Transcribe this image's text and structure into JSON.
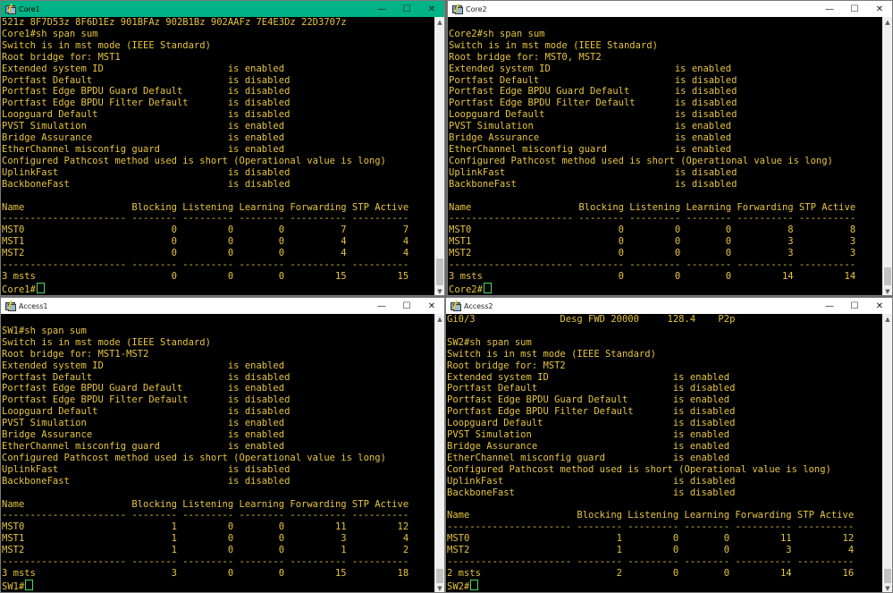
{
  "controls": {
    "minimize": "—",
    "maximize": "☐",
    "close": "✕",
    "scroll_up": "▲",
    "scroll_down": "▼"
  },
  "windows": {
    "core1": {
      "title": "Core1",
      "lines": [
        "521z 8F7D53z 8F6D1Ez 901BFAz 902B1Bz 902AAFz 7E4E3Dz 22D3707z",
        "Core1#sh span sum",
        "Switch is in mst mode (IEEE Standard)",
        "Root bridge for: MST1",
        "Extended system ID                      is enabled",
        "Portfast Default                        is disabled",
        "Portfast Edge BPDU Guard Default        is disabled",
        "Portfast Edge BPDU Filter Default       is disabled",
        "Loopguard Default                       is disabled",
        "PVST Simulation                         is enabled",
        "Bridge Assurance                        is enabled",
        "EtherChannel misconfig guard            is enabled",
        "Configured Pathcost method used is short (Operational value is long)",
        "UplinkFast                              is disabled",
        "BackboneFast                            is disabled",
        "",
        "Name                   Blocking Listening Learning Forwarding STP Active",
        "---------------------- -------- --------- -------- ---------- ----------",
        "MST0                          0         0        0          7          7",
        "MST1                          0         0        0          4          4",
        "MST2                          0         0        0          4          4",
        "---------------------- -------- --------- -------- ---------- ----------",
        "3 msts                        0         0        0         15         15"
      ],
      "prompt": "Core1#"
    },
    "core2": {
      "title": "Core2",
      "lines": [
        "",
        "Core2#sh span sum",
        "Switch is in mst mode (IEEE Standard)",
        "Root bridge for: MST0, MST2",
        "Extended system ID                      is enabled",
        "Portfast Default                        is disabled",
        "Portfast Edge BPDU Guard Default        is disabled",
        "Portfast Edge BPDU Filter Default       is disabled",
        "Loopguard Default                       is disabled",
        "PVST Simulation                         is enabled",
        "Bridge Assurance                        is enabled",
        "EtherChannel misconfig guard            is enabled",
        "Configured Pathcost method used is short (Operational value is long)",
        "UplinkFast                              is disabled",
        "BackboneFast                            is disabled",
        "",
        "Name                   Blocking Listening Learning Forwarding STP Active",
        "---------------------- -------- --------- -------- ---------- ----------",
        "MST0                          0         0        0          8          8",
        "MST1                          0         0        0          3          3",
        "MST2                          0         0        0          3          3",
        "---------------------- -------- --------- -------- ---------- ----------",
        "3 msts                        0         0        0         14         14"
      ],
      "prompt": "Core2#"
    },
    "access1": {
      "title": "Access1",
      "lines": [
        "",
        "SW1#sh span sum",
        "Switch is in mst mode (IEEE Standard)",
        "Root bridge for: MST1-MST2",
        "Extended system ID                      is enabled",
        "Portfast Default                        is disabled",
        "Portfast Edge BPDU Guard Default        is enabled",
        "Portfast Edge BPDU Filter Default       is disabled",
        "Loopguard Default                       is disabled",
        "PVST Simulation                         is enabled",
        "Bridge Assurance                        is enabled",
        "EtherChannel misconfig guard            is enabled",
        "Configured Pathcost method used is short (Operational value is long)",
        "UplinkFast                              is disabled",
        "BackboneFast                            is disabled",
        "",
        "Name                   Blocking Listening Learning Forwarding STP Active",
        "---------------------- -------- --------- -------- ---------- ----------",
        "MST0                          1         0        0         11         12",
        "MST1                          1         0        0          3          4",
        "MST2                          1         0        0          1          2",
        "---------------------- -------- --------- -------- ---------- ----------",
        "3 msts                        3         0        0         15         18"
      ],
      "prompt": "SW1#"
    },
    "access2": {
      "title": "Access2",
      "lines": [
        "Gi0/3               Desg FWD 20000     128.4    P2p",
        "",
        "SW2#sh span sum",
        "Switch is in mst mode (IEEE Standard)",
        "Root bridge for: MST2",
        "Extended system ID                      is enabled",
        "Portfast Default                        is disabled",
        "Portfast Edge BPDU Guard Default        is enabled",
        "Portfast Edge BPDU Filter Default       is disabled",
        "Loopguard Default                       is disabled",
        "PVST Simulation                         is enabled",
        "Bridge Assurance                        is enabled",
        "EtherChannel misconfig guard            is enabled",
        "Configured Pathcost method used is short (Operational value is long)",
        "UplinkFast                              is disabled",
        "BackboneFast                            is disabled",
        "",
        "Name                   Blocking Listening Learning Forwarding STP Active",
        "---------------------- -------- --------- -------- ---------- ----------",
        "MST0                          1         0        0         11         12",
        "MST2                          1         0        0          3          4",
        "---------------------- -------- --------- -------- ---------- ----------",
        "2 msts                        2         0        0         14         16"
      ],
      "prompt": "SW2#"
    }
  }
}
